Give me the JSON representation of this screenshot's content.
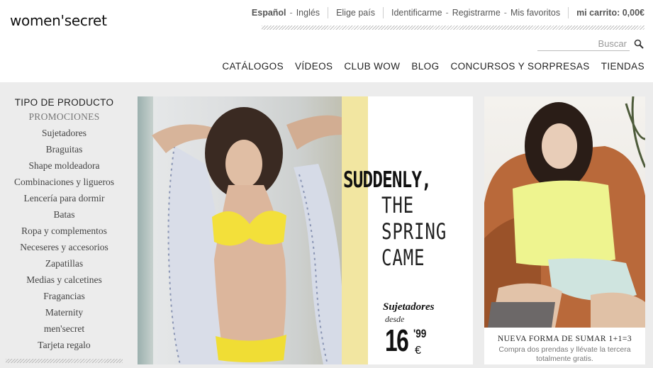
{
  "brand": {
    "logo_text": "women'secret"
  },
  "topbar": {
    "lang_current": "Español",
    "lang_other": "Inglés",
    "country": "Elige país",
    "login": "Identificarme",
    "register": "Registrarme",
    "favorites": "Mis favoritos",
    "cart": "mi carrito: 0,00€"
  },
  "search": {
    "placeholder": "Buscar",
    "icon": "magnifier"
  },
  "nav": {
    "items": [
      "CATÁLOGOS",
      "VÍDEOS",
      "CLUB WOW",
      "BLOG",
      "CONCURSOS Y SORPRESAS",
      "TIENDAS"
    ]
  },
  "sidebar": {
    "title": "TIPO DE PRODUCTO",
    "items": [
      "PROMOCIONES",
      "Sujetadores",
      "Braguitas",
      "Shape moldeadora",
      "Combinaciones y ligueros",
      "Lencería para dormir",
      "Batas",
      "Ropa y complementos",
      "Neceseres y accesorios",
      "Zapatillas",
      "Medias y calcetines",
      "Fragancias",
      "Maternity",
      "men'secret",
      "Tarjeta regalo"
    ]
  },
  "banner": {
    "headline_1": "SUDDENLY,",
    "headline_2": "THE",
    "headline_3": "SPRING",
    "headline_4": "CAME",
    "product": "Sujetadores",
    "from": "desde",
    "price_int": "16",
    "price_dec": "'99",
    "currency": "€"
  },
  "promo": {
    "title": "NUEVA FORMA DE SUMAR 1+1=3",
    "text": "Compra dos prendas y llévate la tercera totalmente gratis."
  },
  "colors": {
    "band_bg": "#ececec",
    "accent_yellow": "#f2e6a1"
  }
}
